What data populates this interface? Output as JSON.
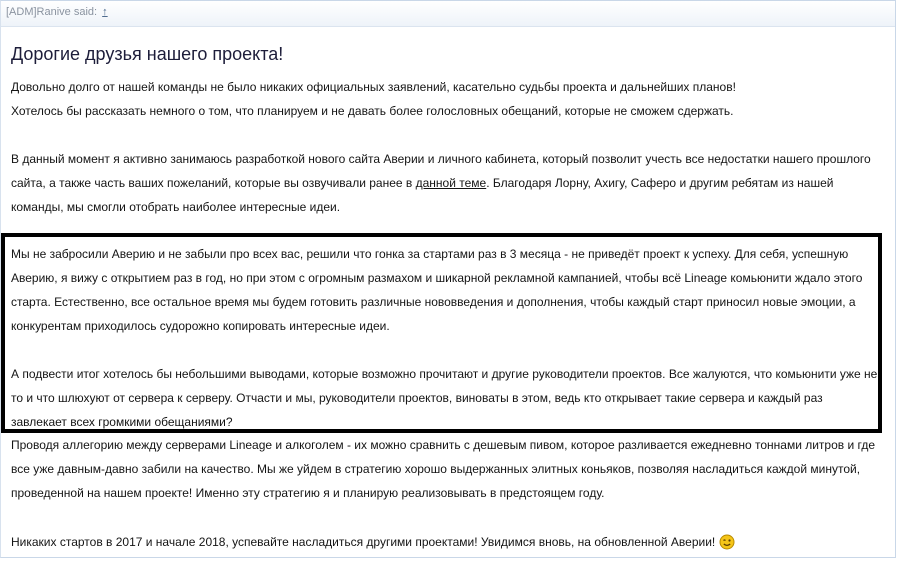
{
  "quote": {
    "author": "[ADM]Ranive said:",
    "goto_label": "↑"
  },
  "post": {
    "title": "Дорогие друзья нашего проекта!",
    "p1_l1": "Довольно долго от нашей команды не было никаких официальных заявлений, касательно судьбы проекта и дальнейших планов!",
    "p1_l2": "Хотелось бы рассказать немного о том, что планируем и не давать более голословных обещаний, которые не сможем сдержать.",
    "p2_l1": "В данный момент я активно занимаюсь разработкой нового сайта Аверии и личного кабинета, который позволит учесть все недостатки нашего прошлого",
    "p2_l2_pre": "сайта, а также часть ваших пожеланий, которые вы озвучивали ранее в ",
    "p2_link": "данной теме",
    "p2_l2_post": ". Благодаря Лорну, Ахигу, Саферо и другим ребятам из нашей",
    "p2_l3": "команды, мы смогли отобрать наиболее интересные идеи.",
    "p3_l1": "Мы не забросили Аверию и не забыли про всех вас, решили что гонка за стартами раз в 3 месяца - не приведёт проект к успеху. Для себя, успешную",
    "p3_l2": "Аверию, я вижу с открытием раз в год, но при этом с огромным размахом и шикарной рекламной кампанией, чтобы всё Lineage комьюнити ждало этого",
    "p3_l3": "старта. Естественно, все остальное время мы будем готовить различные нововведения и дополнения, чтобы каждый старт приносил новые эмоции, а",
    "p3_l4": "конкурентам приходилось судорожно копировать интересные идеи.",
    "p4_l1": "А подвести итог хотелось бы небольшими выводами, которые возможно прочитают и другие руководители проектов. Все жалуются, что комьюнити уже не",
    "p4_l2": "то и что шлюхуют от сервера к серверу. Отчасти и мы, руководители проектов, виноваты в этом, ведь кто открывает такие сервера и каждый раз",
    "p4_l3": "завлекает всех громкими обещаниями?",
    "p5_l1": "Проводя аллегорию между серверами Lineage и алкоголем - их можно сравнить с дешевым пивом, которое разливается ежедневно тоннами литров и где",
    "p5_l2": "все уже давным-давно забили на качество. Мы же уйдем в стратегию хорошо выдержанных элитных коньяков, позволяя насладиться каждой минутой,",
    "p5_l3": "проведенной на нашем проекте! Именно эту стратегию я и планирую реализовывать в предстоящем году.",
    "p6_l1": "Никаких стартов в 2017 и начале 2018, успевайте насладиться другими проектами! Увидимся вновь, на обновленной Аверии!"
  },
  "colors": {
    "border": "#c9d7e8",
    "highlight_box": "#000000",
    "smiley": "#f5c518"
  },
  "icons": {
    "smiley": "wink-smiley-icon",
    "goto": "up-arrow-icon"
  }
}
